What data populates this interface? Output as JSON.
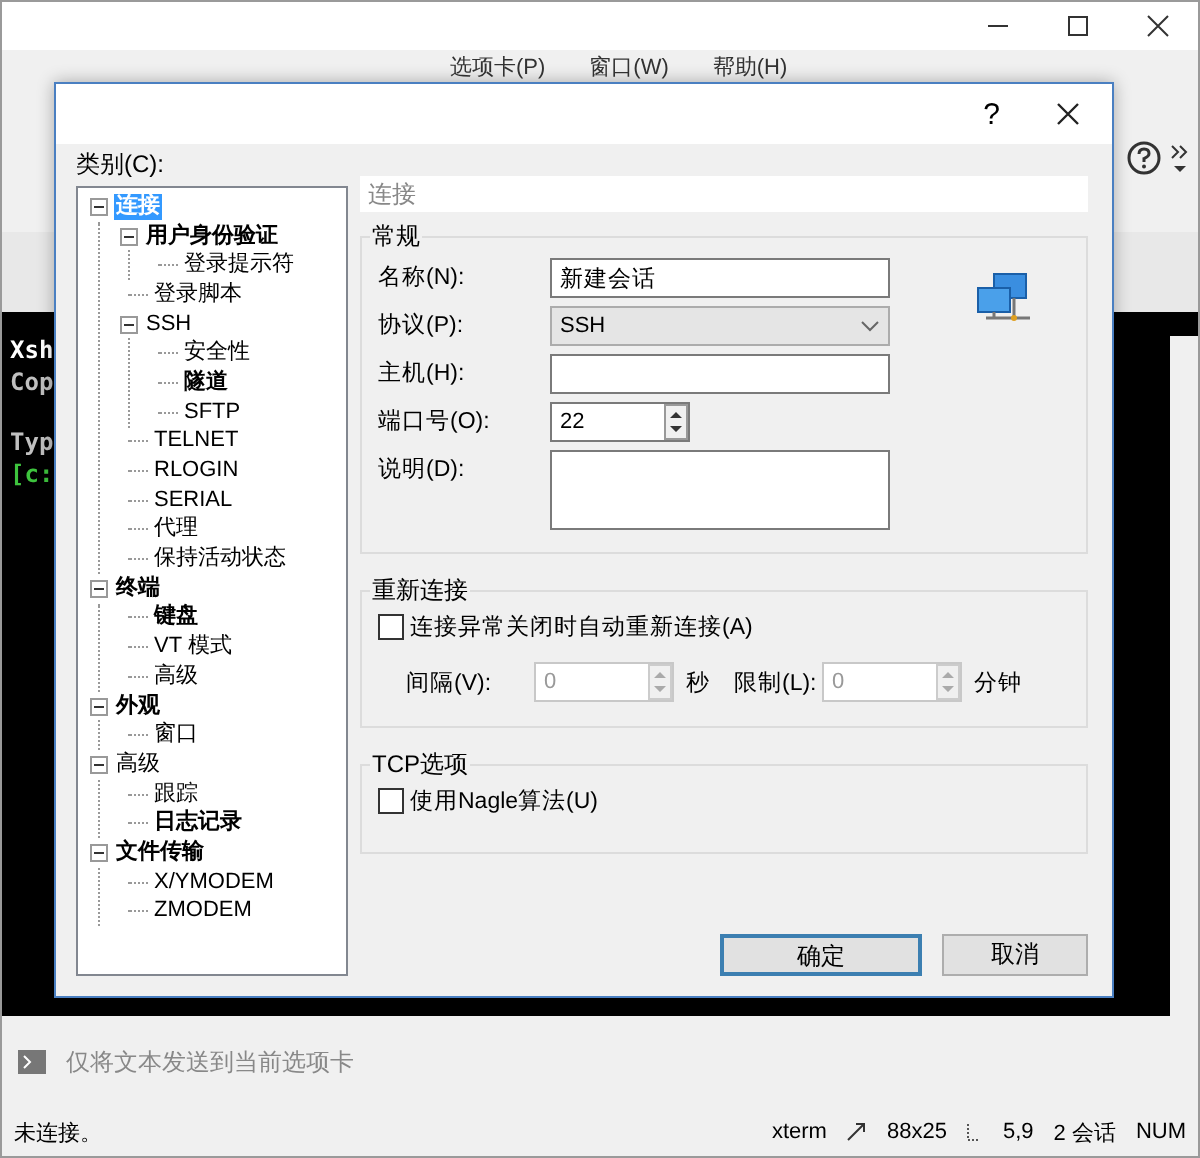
{
  "app": {
    "menu": [
      "选项卡(P)",
      "窗口(W)",
      "帮助(H)"
    ],
    "terminal_lines": [
      {
        "text": "Xsh",
        "color": "#ffffff"
      },
      {
        "text": "Cop",
        "color": "#c0c0c0"
      },
      {
        "text": "Typ",
        "color": "#c0c0c0"
      },
      {
        "text": "[c:",
        "color": "#3ec43e"
      }
    ],
    "compose": {
      "placeholder": "仅将文本发送到当前选项卡"
    },
    "status_bar": [
      "未连接。",
      "xterm",
      "88x25",
      "5,9",
      "2 会话",
      "NUM"
    ]
  },
  "dialog": {
    "help": "?",
    "category_label": "类别(C):",
    "tree": [
      {
        "label": "连接",
        "bold": true,
        "selected": true,
        "expanded": true,
        "children": [
          {
            "label": "用户身份验证",
            "bold": true,
            "selected": false,
            "expanded": true,
            "children": [
              {
                "label": "登录提示符",
                "bold": false,
                "selected": false
              }
            ]
          },
          {
            "label": "登录脚本",
            "bold": false,
            "selected": false
          },
          {
            "label": "SSH",
            "bold": false,
            "selected": false,
            "expanded": true,
            "children": [
              {
                "label": "安全性",
                "bold": false,
                "selected": false
              },
              {
                "label": "隧道",
                "bold": true,
                "selected": false
              },
              {
                "label": "SFTP",
                "bold": false,
                "selected": false
              }
            ]
          },
          {
            "label": "TELNET",
            "bold": false,
            "selected": false
          },
          {
            "label": "RLOGIN",
            "bold": false,
            "selected": false
          },
          {
            "label": "SERIAL",
            "bold": false,
            "selected": false
          },
          {
            "label": "代理",
            "bold": false,
            "selected": false
          },
          {
            "label": "保持活动状态",
            "bold": false,
            "selected": false
          }
        ]
      },
      {
        "label": "终端",
        "bold": true,
        "selected": false,
        "expanded": true,
        "children": [
          {
            "label": "键盘",
            "bold": true,
            "selected": false
          },
          {
            "label": "VT 模式",
            "bold": false,
            "selected": false
          },
          {
            "label": "高级",
            "bold": false,
            "selected": false
          }
        ]
      },
      {
        "label": "外观",
        "bold": true,
        "selected": false,
        "expanded": true,
        "children": [
          {
            "label": "窗口",
            "bold": false,
            "selected": false
          }
        ]
      },
      {
        "label": "高级",
        "bold": false,
        "selected": false,
        "expanded": true,
        "children": [
          {
            "label": "跟踪",
            "bold": false,
            "selected": false
          },
          {
            "label": "日志记录",
            "bold": true,
            "selected": false
          }
        ]
      },
      {
        "label": "文件传输",
        "bold": true,
        "selected": false,
        "expanded": true,
        "children": [
          {
            "label": "X/YMODEM",
            "bold": false,
            "selected": false
          },
          {
            "label": "ZMODEM",
            "bold": false,
            "selected": false
          }
        ]
      }
    ],
    "panel_title": "连接",
    "general": {
      "title": "常规",
      "fields": [
        {
          "kind": "text",
          "label": "名称(N):",
          "value": "新建会话"
        },
        {
          "kind": "select",
          "label": "协议(P):",
          "value": "SSH"
        },
        {
          "kind": "text",
          "label": "主机(H):"
        },
        {
          "kind": "spin",
          "label": "端口号(O):",
          "value": "22"
        },
        {
          "kind": "textarea",
          "label": "说明(D):"
        }
      ]
    },
    "reconnect": {
      "title": "重新连接",
      "checkbox": {
        "label": "连接异常关闭时自动重新连接(A)",
        "checked": false
      },
      "spinners": [
        {
          "label": "间隔(V):",
          "value": "0",
          "unit": "秒",
          "disabled": true
        },
        {
          "label": "限制(L):",
          "value": "0",
          "unit": "分钟",
          "disabled": true
        }
      ]
    },
    "tcp": {
      "title": "TCP选项",
      "checkbox": {
        "label": "使用Nagle算法(U)",
        "checked": false
      }
    },
    "buttons": [
      {
        "label": "确定",
        "default": true
      },
      {
        "label": "取消",
        "default": false
      }
    ]
  }
}
